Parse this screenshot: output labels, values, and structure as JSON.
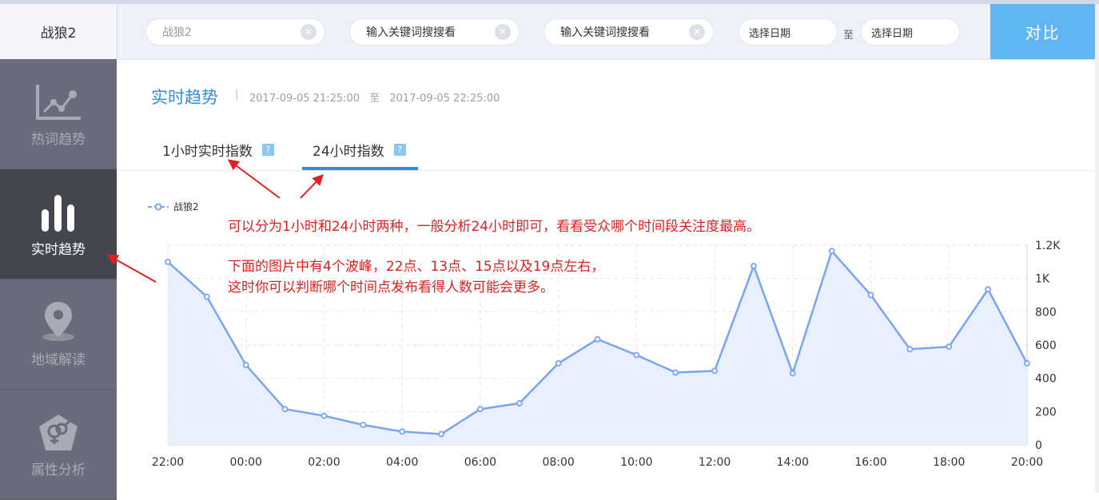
{
  "header": {
    "brand": "战狼2",
    "search": [
      {
        "value": "战狼2",
        "placeholder": "输入关键词搜搜看"
      },
      {
        "value": "",
        "placeholder": "输入关键词搜搜看"
      },
      {
        "value": "",
        "placeholder": "输入关键词搜搜看"
      }
    ],
    "date_start_placeholder": "选择日期",
    "date_to": "至",
    "date_end_placeholder": "选择日期",
    "compare_label": "对比"
  },
  "sidebar": {
    "items": [
      {
        "label": "热词趋势",
        "icon": "line-chart-icon",
        "active": false
      },
      {
        "label": "实时趋势",
        "icon": "bars-icon",
        "active": true
      },
      {
        "label": "地域解读",
        "icon": "location-pin-icon",
        "active": false
      },
      {
        "label": "属性分析",
        "icon": "gender-icon",
        "active": false
      }
    ]
  },
  "main": {
    "title": "实时趋势",
    "separator": "|",
    "range_start": "2017-09-05 21:25:00",
    "range_to": "至",
    "range_end": "2017-09-05 22:25:00",
    "tabs": [
      {
        "label": "1小时实时指数",
        "help": "?",
        "active": false
      },
      {
        "label": "24小时指数",
        "help": "?",
        "active": true
      }
    ],
    "annotation_1": "可以分为1小时和24小时两种，一般分析24小时即可，看看受众哪个时间段关注度最高。",
    "annotation_2_line1": "下面的图片中有4个波峰，22点、13点、15点以及19点左右，",
    "annotation_2_line2": "这时你可以判断哪个时间点发布看得人数可能会更多。"
  },
  "colors": {
    "accent": "#2e8ee0",
    "line": "#7aa4f0",
    "area": "#e8effd",
    "annotation": "#e02020",
    "sidebar": "#5d6170",
    "sidebar_active": "#43464f",
    "compare_button": "#5fb6f2"
  },
  "chart_data": {
    "type": "area",
    "series": [
      {
        "name": "战狼2",
        "values": [
          1100,
          890,
          480,
          215,
          175,
          120,
          80,
          65,
          215,
          250,
          490,
          635,
          540,
          435,
          445,
          1075,
          430,
          1165,
          900,
          575,
          590,
          935,
          490
        ]
      }
    ],
    "x": [
      "22:00",
      "23:00",
      "00:00",
      "01:00",
      "02:00",
      "03:00",
      "04:00",
      "05:00",
      "06:00",
      "07:00",
      "08:00",
      "09:00",
      "10:00",
      "11:00",
      "12:00",
      "13:00",
      "14:00",
      "15:00",
      "16:00",
      "17:00",
      "18:00",
      "19:00",
      "20:00"
    ],
    "x_tick_labels": [
      "22:00",
      "00:00",
      "02:00",
      "04:00",
      "06:00",
      "08:00",
      "10:00",
      "12:00",
      "14:00",
      "16:00",
      "18:00",
      "20:00"
    ],
    "y_tick_labels": [
      "0",
      "200",
      "400",
      "600",
      "800",
      "1K",
      "1.2K"
    ],
    "ylim": [
      0,
      1200
    ],
    "y_axis_side": "right",
    "grid": true,
    "legend": "top-left"
  }
}
